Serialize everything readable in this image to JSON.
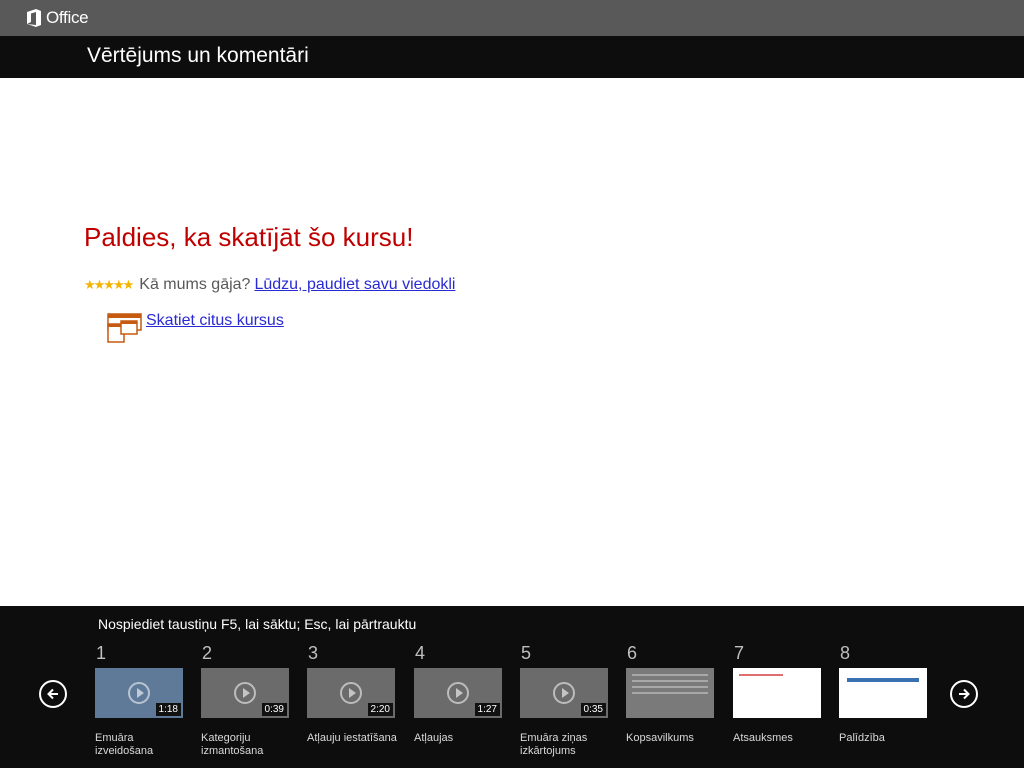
{
  "app": {
    "logo_text": "Office"
  },
  "header": {
    "title": "Vērtējums un komentāri"
  },
  "main": {
    "thanks": "Paldies, ka skatījāt šo kursu!",
    "stars": "★★★★★",
    "rating_question": "Kā mums gāja?",
    "rating_link": "Lūdzu, paudiet savu viedokli",
    "more_courses_link": "Skatiet citus kursus"
  },
  "footer": {
    "hint": "Nospiediet taustiņu F5, lai sāktu; Esc, lai pārtrauktu",
    "slides": [
      {
        "num": "1",
        "label": "Emuāra izveidošana",
        "duration": "1:18"
      },
      {
        "num": "2",
        "label": "Kategoriju izmantošana",
        "duration": "0:39"
      },
      {
        "num": "3",
        "label": "Atļauju iestatīšana",
        "duration": "2:20"
      },
      {
        "num": "4",
        "label": "Atļaujas",
        "duration": "1:27"
      },
      {
        "num": "5",
        "label": "Emuāra ziņas izkārtojums",
        "duration": "0:35"
      },
      {
        "num": "6",
        "label": "Kopsavilkums"
      },
      {
        "num": "7",
        "label": "Atsauksmes"
      },
      {
        "num": "8",
        "label": "Palīdzība"
      }
    ]
  },
  "colors": {
    "title_red": "#c00000",
    "link_blue": "#2a2ad4",
    "star": "#f5b400",
    "bar_dark": "#0d0d0d",
    "topbar": "#595959"
  },
  "icons": {
    "prev": "arrow-left-circle-icon",
    "next": "arrow-right-circle-icon",
    "courses": "courses-windows-icon",
    "logo": "office-logo-icon"
  }
}
